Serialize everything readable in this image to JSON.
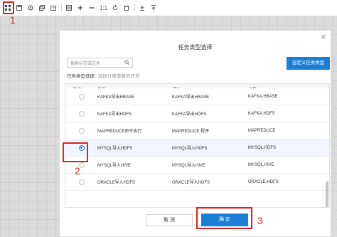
{
  "toolbar": {
    "icons": [
      "grid-icon",
      "save-icon",
      "settings-icon",
      "copy-icon",
      "export-icon",
      "table-icon",
      "zoom-in-icon",
      "zoom-out-icon",
      "refresh-icon",
      "delete-icon",
      "download-icon",
      "upload-icon"
    ],
    "ratio_label": "1:1"
  },
  "dialog": {
    "title": "任务类型选择",
    "search_placeholder": "搜索标签或任务",
    "custom_button": "自定义任务类型",
    "selected_label": "任务类型选择:",
    "selected_hint": "选择计算需要的任务",
    "table": {
      "headers": [
        "选择",
        "任务",
        "描述",
        "标签"
      ],
      "rows": [
        {
          "task": "KAFKA导出HBASE",
          "desc": "KAFKA导出HBASE",
          "tag": "KAFKA,HBASE",
          "selected": false
        },
        {
          "task": "KAFKA导出HDFS",
          "desc": "KAFKA导出HDFS",
          "tag": "KAFKA,HDFS",
          "selected": false
        },
        {
          "task": "MAPREDUCE命令执行",
          "desc": "MAPREDUCE 程序",
          "tag": "MAPREDUCE",
          "selected": false
        },
        {
          "task": "MYSQL导入HDFS",
          "desc": "MYSQL导入HDFS",
          "tag": "MYSQL,HDFS",
          "selected": true
        },
        {
          "task": "MYSQL导入HIVE",
          "desc": "MYSQL导入HIVE",
          "tag": "MYSQL,HIVE",
          "selected": false
        },
        {
          "task": "ORACLE导入HDFS",
          "desc": "ORACLE导入HDFS",
          "tag": "ORACLE,HDFS",
          "selected": false
        }
      ]
    },
    "cancel_button": "取 消",
    "ok_button": "确 定"
  },
  "annotations": [
    "1",
    "2",
    "3"
  ],
  "colors": {
    "accent": "#1a7ed5",
    "annotation": "#e02020"
  }
}
